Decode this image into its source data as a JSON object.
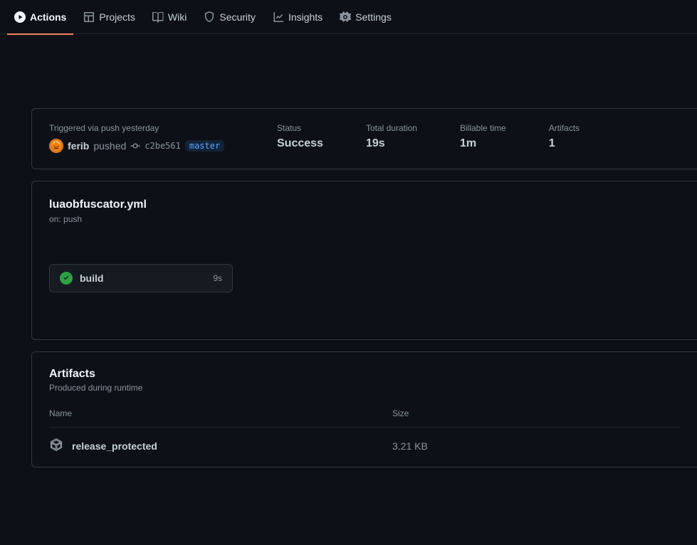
{
  "nav": {
    "actions": "Actions",
    "projects": "Projects",
    "wiki": "Wiki",
    "security": "Security",
    "insights": "Insights",
    "settings": "Settings"
  },
  "summary": {
    "trigger_line": "Triggered via push yesterday",
    "actor": "ferib",
    "pushed_word": "pushed",
    "commit_sha": "c2be561",
    "branch": "master",
    "status_label": "Status",
    "status_value": "Success",
    "duration_label": "Total duration",
    "duration_value": "19s",
    "billable_label": "Billable time",
    "billable_value": "1m",
    "artifacts_label": "Artifacts",
    "artifacts_value": "1"
  },
  "workflow": {
    "filename": "luaobfuscator.yml",
    "on_text": "on: push",
    "job_name": "build",
    "job_time": "9s"
  },
  "artifacts": {
    "title": "Artifacts",
    "subtitle": "Produced during runtime",
    "col_name": "Name",
    "col_size": "Size",
    "items": [
      {
        "name": "release_protected",
        "size": "3.21 KB"
      }
    ]
  }
}
